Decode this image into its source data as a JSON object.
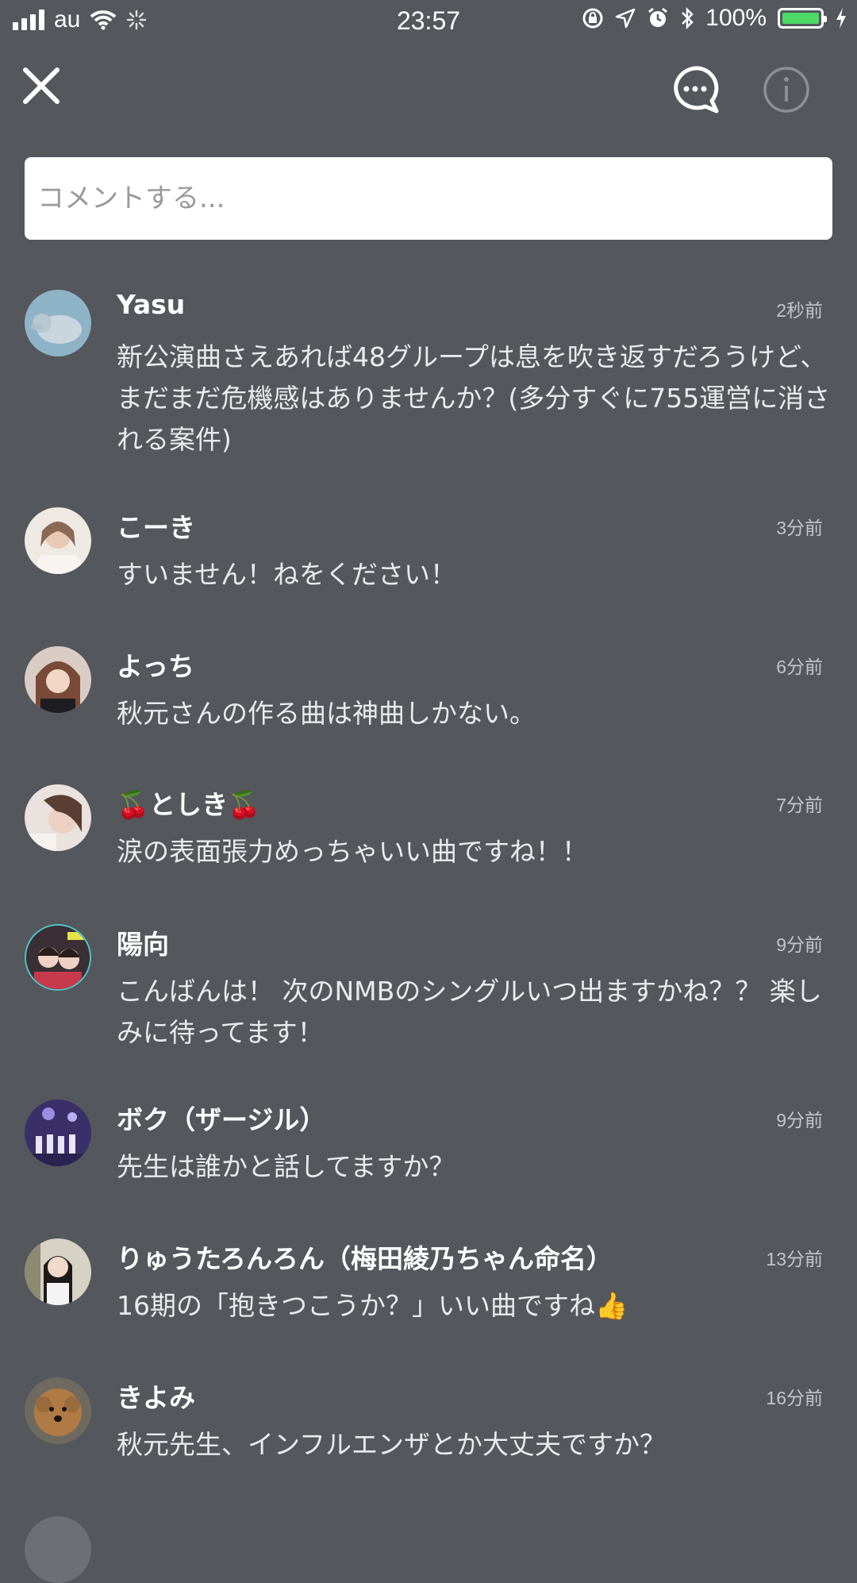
{
  "status_bar": {
    "carrier": "au",
    "time": "23:57",
    "battery": "100%",
    "battery_level": 1.0
  },
  "header": {
    "close_icon": "close-icon",
    "chat_icon": "chat-bubble-icon",
    "info_icon": "info-icon"
  },
  "comment_box": {
    "placeholder": "コメントする..."
  },
  "comments": [
    {
      "name": "Yasu",
      "time": "2秒前",
      "text": "新公演曲さえあれば48グループは息を吹き返すだろうけど、まだまだ危機感はありませんか？(多分すぐに755運営に消される案件)"
    },
    {
      "name": "こーき",
      "time": "3分前",
      "text": "すいません！ねをください！"
    },
    {
      "name": "よっち",
      "time": "6分前",
      "text": "秋元さんの作る曲は神曲しかない。"
    },
    {
      "name": "🍒としき🍒",
      "time": "7分前",
      "text": "涙の表面張力めっちゃいい曲ですね！！"
    },
    {
      "name": "陽向",
      "time": "9分前",
      "text": "こんばんは！ 次のNMBのシングルいつ出ますかね？？ 楽しみに待ってます！"
    },
    {
      "name": "ボク（ザージル）",
      "time": "9分前",
      "text": "先生は誰かと話してますか？"
    },
    {
      "name": "りゅうたろんろん（梅田綾乃ちゃん命名）",
      "time": "13分前",
      "text": "16期の「抱きつこうか？」いい曲ですね👍"
    },
    {
      "name": "きよみ",
      "time": "16分前",
      "text": "秋元先生、インフルエンザとか大丈夫ですか？"
    }
  ],
  "colors": {
    "background": "#54575c",
    "battery_fill": "#4cd964",
    "timestamp": "#c3c5c8"
  }
}
